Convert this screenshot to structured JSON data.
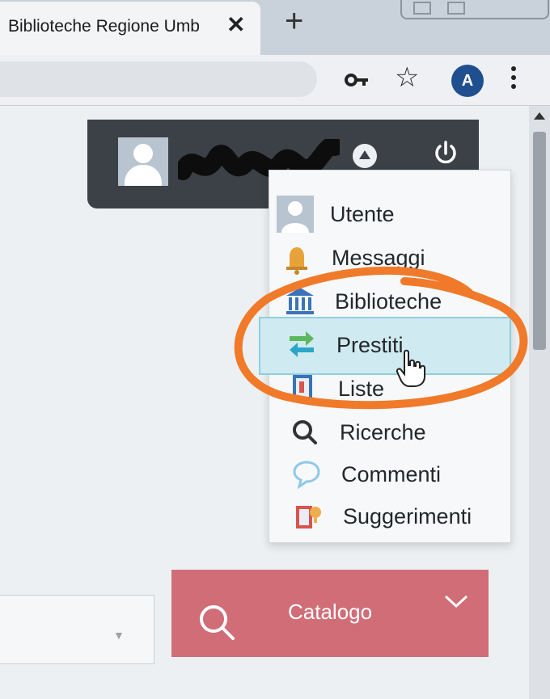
{
  "tab": {
    "title": "Biblioteche Regione Umb",
    "close_label": "✕",
    "new_tab_label": "+"
  },
  "toolbar": {
    "avatar_initial": "A"
  },
  "user": {
    "name_redacted": ""
  },
  "menu": {
    "items": [
      {
        "label": "Utente",
        "icon": "user-icon"
      },
      {
        "label": "Messaggi",
        "icon": "bell-icon"
      },
      {
        "label": "Biblioteche",
        "icon": "library-icon"
      },
      {
        "label": "Prestiti",
        "icon": "loan-arrows-icon"
      },
      {
        "label": "Liste",
        "icon": "book-list-icon"
      },
      {
        "label": "Ricerche",
        "icon": "search-icon"
      },
      {
        "label": "Commenti",
        "icon": "comment-icon"
      },
      {
        "label": "Suggerimenti",
        "icon": "suggestion-icon"
      }
    ],
    "highlighted": "Prestiti"
  },
  "search": {
    "button_label": "Catalogo"
  },
  "colors": {
    "header": "#3b4146",
    "search_button": "#d06d77",
    "highlight": "#cfeaf0",
    "annotation": "#f07a2a"
  }
}
